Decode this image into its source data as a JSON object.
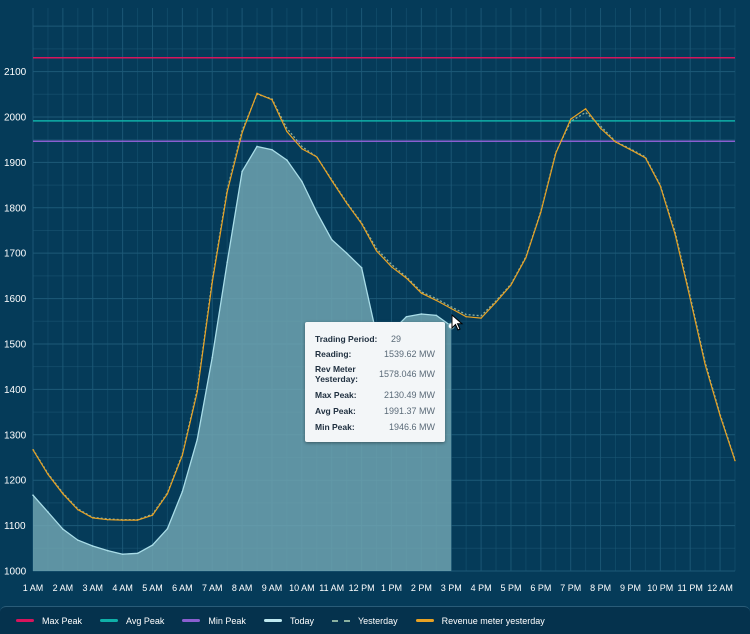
{
  "chart_data": {
    "type": "line",
    "ylim": [
      1000,
      2240
    ],
    "y_ticks": [
      1000,
      1100,
      1200,
      1300,
      1400,
      1500,
      1600,
      1700,
      1800,
      1900,
      2000,
      2100
    ],
    "x_ticks": [
      "1 AM",
      "2 AM",
      "3 AM",
      "4 AM",
      "5 AM",
      "6 AM",
      "7 AM",
      "8 AM",
      "9 AM",
      "10 AM",
      "11 AM",
      "12 PM",
      "1 PM",
      "2 PM",
      "3 PM",
      "4 PM",
      "5 PM",
      "6 PM",
      "7 PM",
      "8 PM",
      "9 PM",
      "10 PM",
      "11 PM",
      "12 AM"
    ],
    "x_range": [
      1,
      48
    ],
    "reference_lines": [
      {
        "name": "Max Peak",
        "value": 2130.49,
        "color": "#d8145c"
      },
      {
        "name": "Avg Peak",
        "value": 1991.37,
        "color": "#0fb0a8"
      },
      {
        "name": "Min Peak",
        "value": 1946.6,
        "color": "#8a5fd0"
      }
    ],
    "series": [
      {
        "name": "Today",
        "color": "#a9dde8",
        "type": "area",
        "x": [
          1,
          2,
          3,
          4,
          5,
          6,
          7,
          8,
          9,
          10,
          11,
          12,
          13,
          14,
          15,
          16,
          17,
          18,
          19,
          20,
          21,
          22,
          23,
          24,
          25,
          26,
          27,
          28,
          29
        ],
        "values": [
          1167,
          1130,
          1092,
          1068,
          1055,
          1045,
          1037,
          1039,
          1057,
          1093,
          1175,
          1290,
          1470,
          1680,
          1880,
          1935,
          1928,
          1905,
          1858,
          1790,
          1730,
          1700,
          1668,
          1520,
          1527,
          1560,
          1566,
          1563,
          1539.62
        ]
      },
      {
        "name": "Yesterday",
        "color": "#8ab0a0",
        "type": "dashed",
        "x": [
          1,
          2,
          3,
          4,
          5,
          6,
          7,
          8,
          9,
          10,
          11,
          12,
          13,
          14,
          15,
          16,
          17,
          18,
          19,
          20,
          21,
          22,
          23,
          24,
          25,
          26,
          27,
          28,
          29,
          30,
          31,
          32,
          33,
          34,
          35,
          36,
          37,
          38,
          39,
          40,
          41,
          42,
          43,
          44,
          45,
          46,
          47,
          48
        ],
        "values": [
          1268,
          1215,
          1172,
          1137,
          1118,
          1115,
          1113,
          1113,
          1125,
          1172,
          1258,
          1400,
          1640,
          1840,
          1970,
          2050,
          2040,
          1975,
          1935,
          1912,
          1862,
          1812,
          1767,
          1710,
          1675,
          1648,
          1615,
          1600,
          1582,
          1565,
          1562,
          1595,
          1632,
          1692,
          1792,
          1922,
          1990,
          2010,
          1980,
          1946,
          1930,
          1912,
          1850,
          1745,
          1605,
          1460,
          1345,
          1245
        ]
      },
      {
        "name": "Revenue meter yesterday",
        "color": "#e8a224",
        "type": "line",
        "x": [
          1,
          2,
          3,
          4,
          5,
          6,
          7,
          8,
          9,
          10,
          11,
          12,
          13,
          14,
          15,
          16,
          17,
          18,
          19,
          20,
          21,
          22,
          23,
          24,
          25,
          26,
          27,
          28,
          29,
          30,
          31,
          32,
          33,
          34,
          35,
          36,
          37,
          38,
          39,
          40,
          41,
          42,
          43,
          44,
          45,
          46,
          47,
          48
        ],
        "values": [
          1267,
          1213,
          1170,
          1135,
          1117,
          1113,
          1112,
          1112,
          1123,
          1170,
          1255,
          1395,
          1635,
          1835,
          1965,
          2052,
          2038,
          1968,
          1930,
          1912,
          1860,
          1810,
          1765,
          1705,
          1670,
          1645,
          1612,
          1596,
          1578.046,
          1560,
          1557,
          1592,
          1630,
          1690,
          1790,
          1920,
          1995,
          2018,
          1975,
          1945,
          1928,
          1910,
          1848,
          1740,
          1600,
          1455,
          1342,
          1243
        ]
      }
    ]
  },
  "tooltip": {
    "trading_period_label": "Trading Period:",
    "trading_period_value": "29",
    "reading_label": "Reading:",
    "reading_value": "1539.62 MW",
    "rev_meter_label_1": "Rev Meter",
    "rev_meter_label_2": "Yesterday:",
    "rev_meter_value": "1578.046 MW",
    "max_peak_label": "Max Peak:",
    "max_peak_value": "2130.49 MW",
    "avg_peak_label": "Avg Peak:",
    "avg_peak_value": "1991.37 MW",
    "min_peak_label": "Min Peak:",
    "min_peak_value": "1946.6 MW"
  },
  "legend": {
    "items": [
      {
        "label": "Max Peak",
        "color": "#d8145c",
        "style": "solid"
      },
      {
        "label": "Avg Peak",
        "color": "#0fb0a8",
        "style": "solid"
      },
      {
        "label": "Min Peak",
        "color": "#8a5fd0",
        "style": "solid"
      },
      {
        "label": "Today",
        "color": "#bfe9f0",
        "style": "solid"
      },
      {
        "label": "Yesterday",
        "color": "#8ab0a0",
        "style": "dashed"
      },
      {
        "label": "Revenue meter yesterday",
        "color": "#e8a224",
        "style": "solid"
      }
    ]
  },
  "cursor_icon": "mouse-pointer-icon"
}
